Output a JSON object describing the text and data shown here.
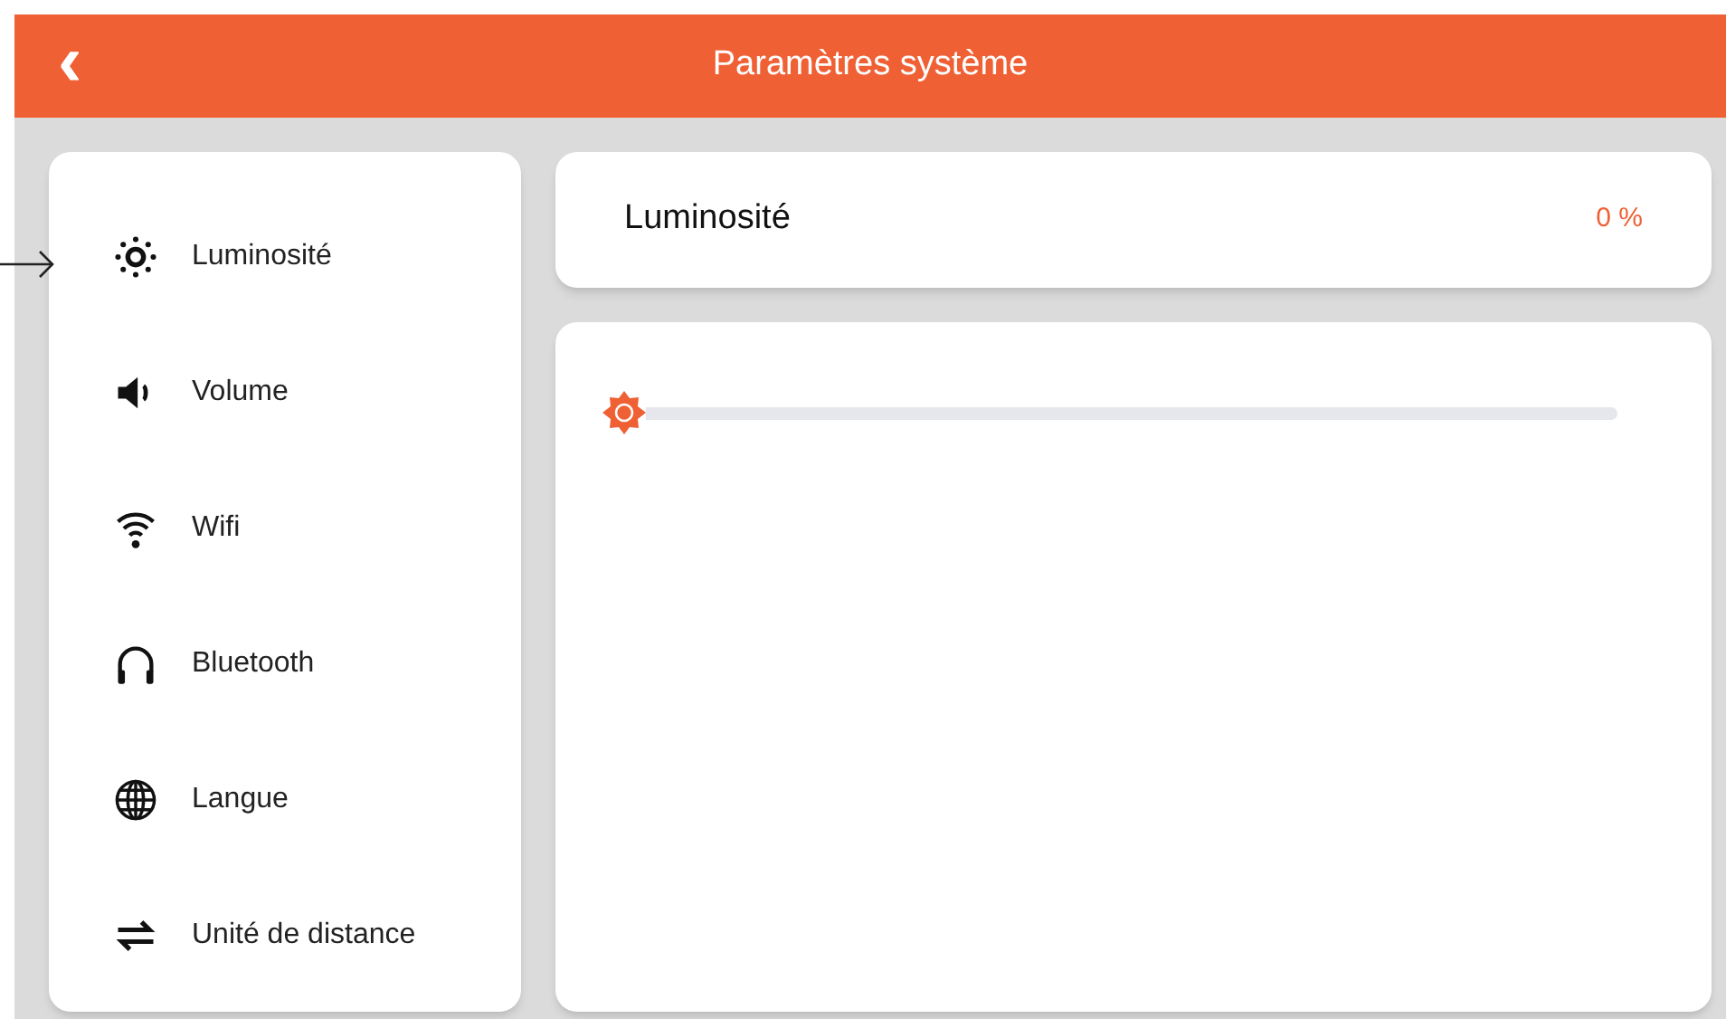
{
  "header": {
    "back": "‹",
    "title": "Paramètres système"
  },
  "sidebar": {
    "items": [
      {
        "label": "Luminosité"
      },
      {
        "label": "Volume"
      },
      {
        "label": "Wifi"
      },
      {
        "label": "Bluetooth"
      },
      {
        "label": "Langue"
      },
      {
        "label": "Unité de distance"
      }
    ]
  },
  "setting": {
    "title": "Luminosité",
    "value": "0 %",
    "level": 0
  }
}
